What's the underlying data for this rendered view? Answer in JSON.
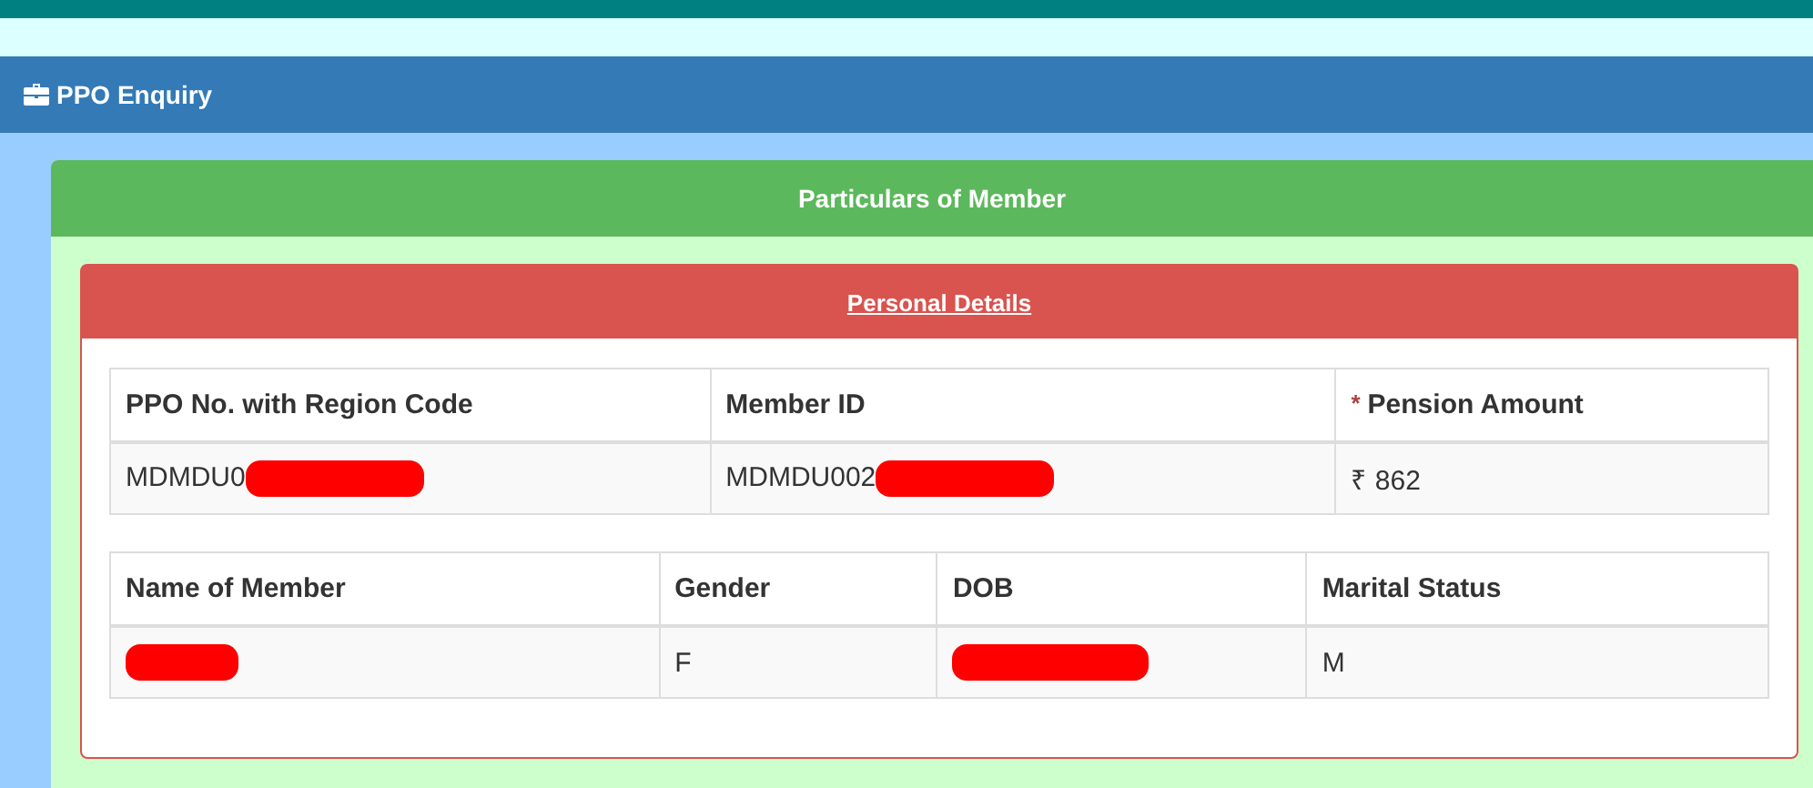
{
  "page_header": {
    "title": "PPO Enquiry"
  },
  "panel": {
    "title": "Particulars of Member",
    "section": {
      "title": "Personal Details",
      "tables": [
        {
          "columns": [
            {
              "label": "PPO No. with Region Code"
            },
            {
              "label": "Member ID"
            },
            {
              "label": "Pension Amount",
              "required_mark": "*"
            }
          ],
          "row": [
            {
              "text": "MDMDU0",
              "redacted": true
            },
            {
              "text": "MDMDU002",
              "redacted": true
            },
            {
              "text": "₹ 862",
              "redacted": false
            }
          ]
        },
        {
          "columns": [
            {
              "label": "Name of Member"
            },
            {
              "label": "Gender"
            },
            {
              "label": "DOB"
            },
            {
              "label": "Marital Status"
            }
          ],
          "row": [
            {
              "redacted": true
            },
            {
              "text": "F",
              "redacted": false
            },
            {
              "redacted": true
            },
            {
              "text": "M",
              "redacted": false
            }
          ]
        }
      ]
    }
  }
}
